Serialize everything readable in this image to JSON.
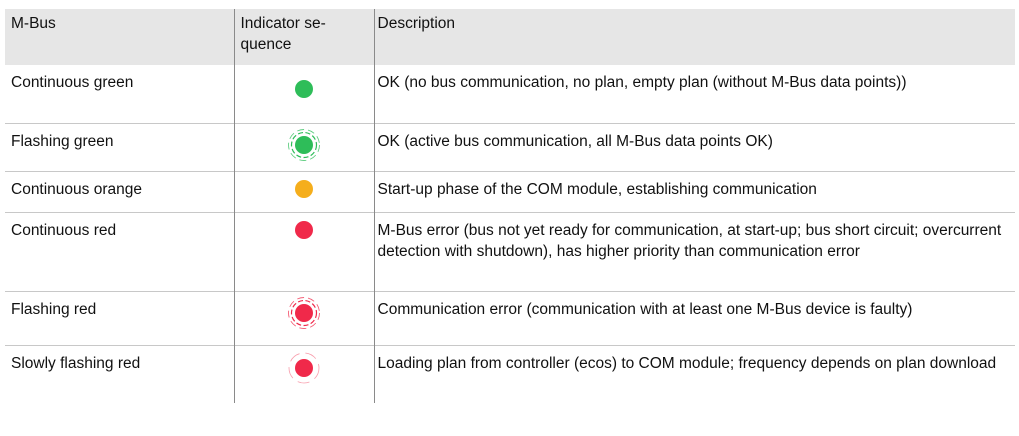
{
  "header": {
    "col1": "M-Bus",
    "col2": "Indicator se-\nquence",
    "col3": "Description"
  },
  "colors": {
    "green": "#2ebd59",
    "orange": "#f5ae1c",
    "red": "#f0294a"
  },
  "rows": [
    {
      "mbus": "Continuous green",
      "indicator": "green-dot-icon",
      "pattern": "continuous",
      "description": "OK (no bus communication, no plan, empty plan (without M-Bus data points))"
    },
    {
      "mbus": "Flashing green",
      "indicator": "green-flashing-dot-icon",
      "pattern": "flashing",
      "description": "OK (active bus communication, all M-Bus data points OK)"
    },
    {
      "mbus": "Continuous orange",
      "indicator": "orange-dot-icon",
      "pattern": "continuous",
      "description": "Start-up phase of the COM module, establishing communication"
    },
    {
      "mbus": "Continuous red",
      "indicator": "red-dot-icon",
      "pattern": "continuous",
      "description": "M-Bus error (bus not yet ready for communication, at start-up; bus short circuit; overcurrent detection with shutdown), has higher priority than communication error"
    },
    {
      "mbus": "Flashing red",
      "indicator": "red-flashing-dot-icon",
      "pattern": "flashing",
      "description": "Communication error (communication with at least one M-Bus device is faulty)"
    },
    {
      "mbus": "Slowly flashing red",
      "indicator": "red-slow-flashing-dot-icon",
      "pattern": "slow-flashing",
      "description": "Loading plan from controller (ecos) to COM module; frequency depends on plan download"
    }
  ]
}
